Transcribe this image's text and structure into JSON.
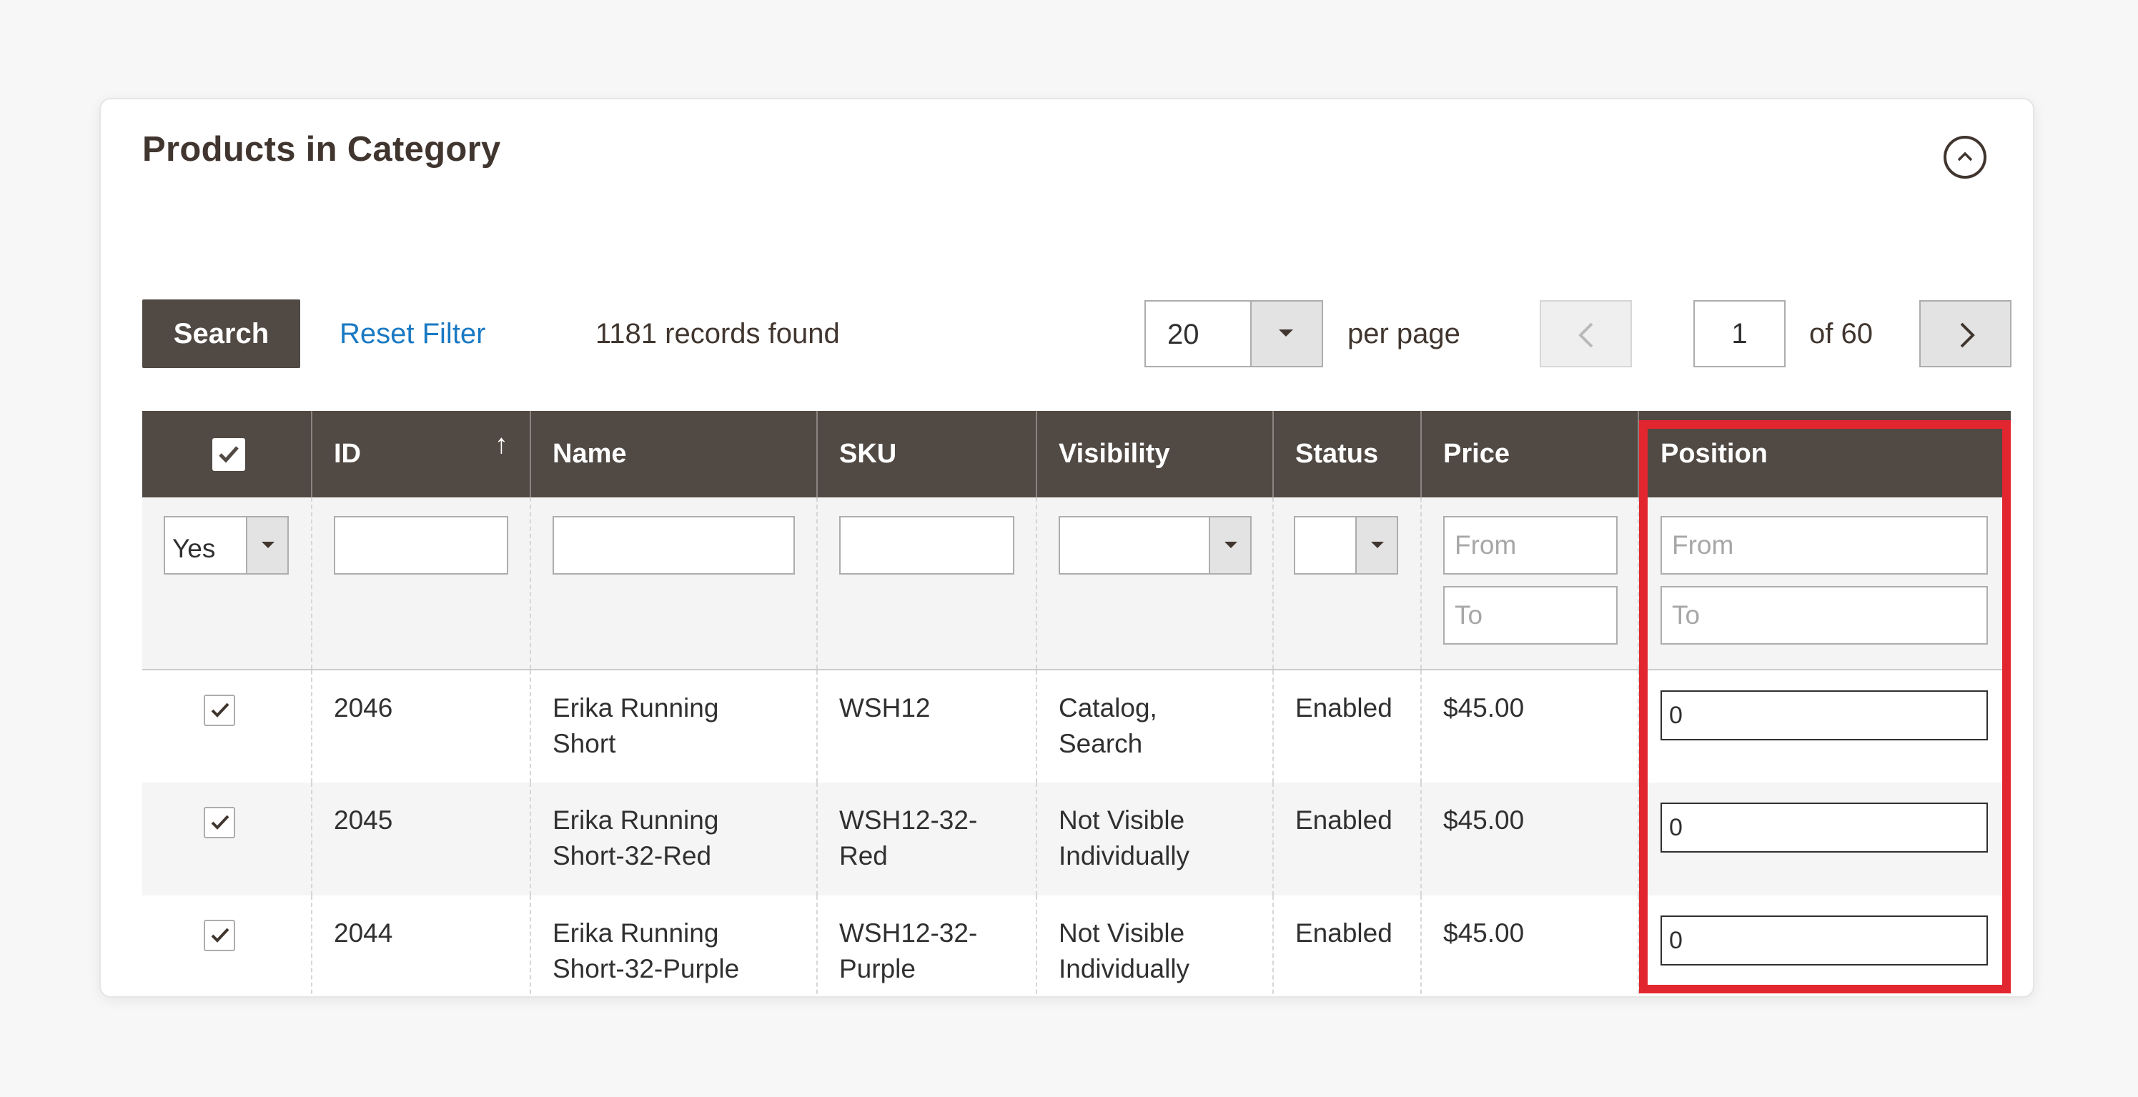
{
  "panel": {
    "title": "Products in Category",
    "collapse_icon": "chevron-up-circle-icon"
  },
  "toolbar": {
    "search_label": "Search",
    "reset_label": "Reset Filter",
    "records_text": "1181 records found",
    "per_page_value": "20",
    "per_page_label": "per page",
    "page_value": "1",
    "page_total_text": "of 60"
  },
  "table": {
    "columns": [
      "ID",
      "Name",
      "SKU",
      "Visibility",
      "Status",
      "Price",
      "Position"
    ],
    "filters": {
      "in_category_value": "Yes",
      "price_from_placeholder": "From",
      "price_to_placeholder": "To",
      "position_from_placeholder": "From",
      "position_to_placeholder": "To"
    },
    "rows": [
      {
        "id": "2046",
        "name": "Erika Running Short",
        "sku": "WSH12",
        "visibility": "Catalog, Search",
        "status": "Enabled",
        "price": "$45.00",
        "position": "0"
      },
      {
        "id": "2045",
        "name": "Erika Running Short-32-Red",
        "sku": "WSH12-32-Red",
        "visibility": "Not Visible Individually",
        "status": "Enabled",
        "price": "$45.00",
        "position": "0"
      },
      {
        "id": "2044",
        "name": "Erika Running Short-32-Purple",
        "sku": "WSH12-32-Purple",
        "visibility": "Not Visible Individually",
        "status": "Enabled",
        "price": "$45.00",
        "position": "0"
      }
    ]
  },
  "colors": {
    "header_bg": "#514943",
    "link": "#1979c3",
    "highlight": "#e2262f"
  }
}
